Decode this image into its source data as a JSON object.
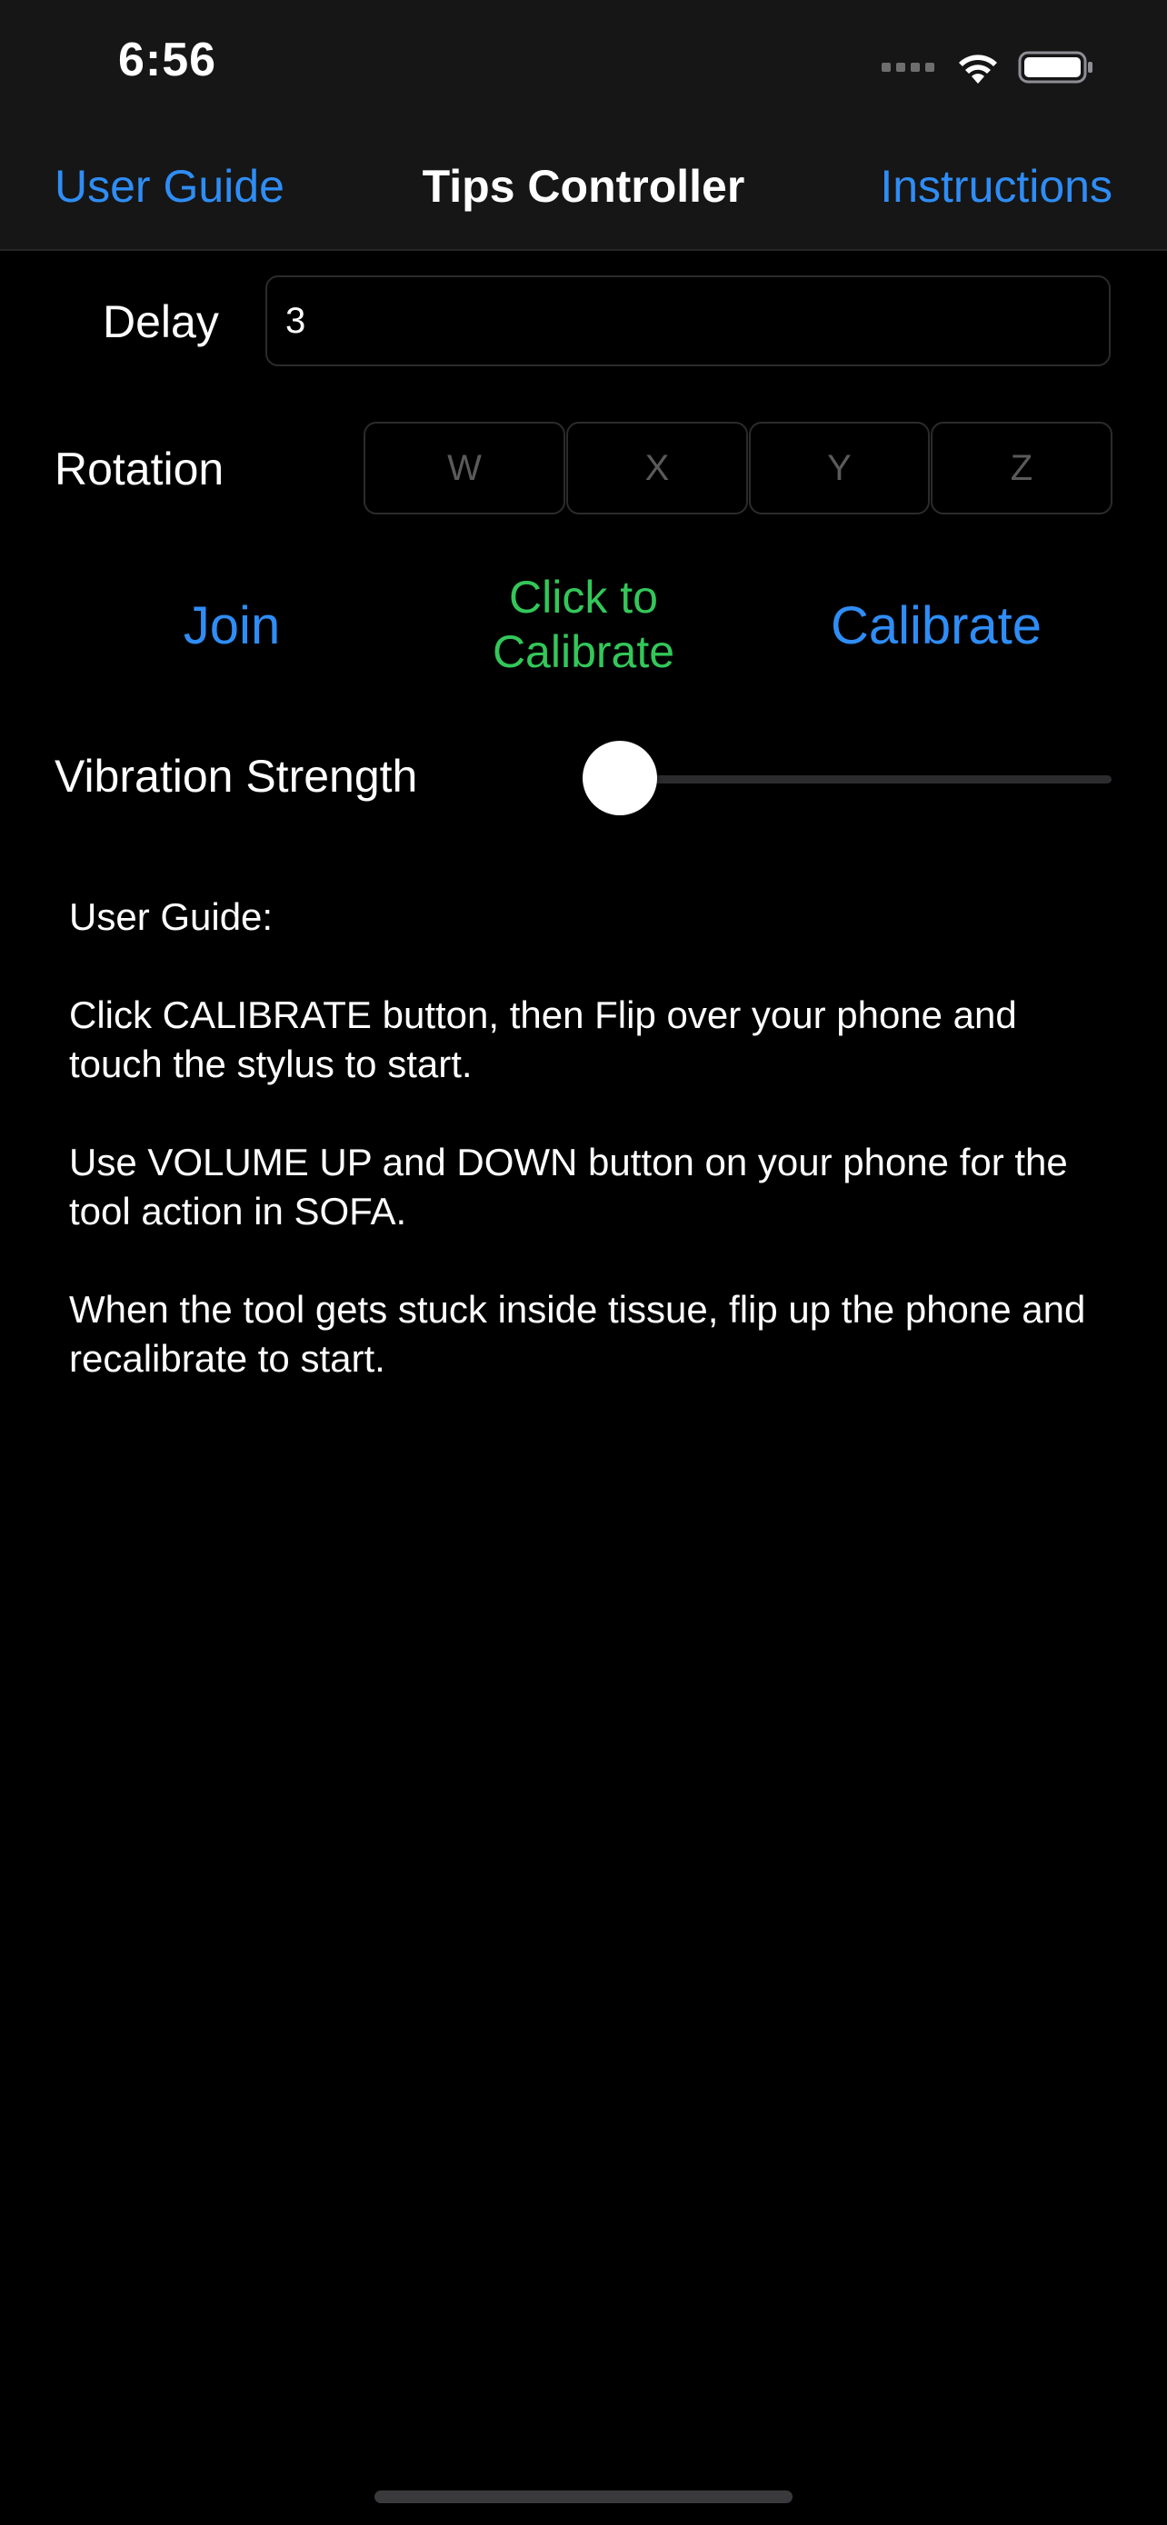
{
  "status_bar": {
    "time": "6:56",
    "icons": [
      "cellular-signal-icon",
      "wifi-icon",
      "battery-icon"
    ]
  },
  "nav": {
    "left_label": "User Guide",
    "title": "Tips Controller",
    "right_label": "Instructions"
  },
  "delay": {
    "label": "Delay",
    "value": "3"
  },
  "rotation": {
    "label": "Rotation",
    "fields": [
      {
        "placeholder": "W",
        "value": ""
      },
      {
        "placeholder": "X",
        "value": ""
      },
      {
        "placeholder": "Y",
        "value": ""
      },
      {
        "placeholder": "Z",
        "value": ""
      }
    ]
  },
  "actions": {
    "join_label": "Join",
    "status_text": "Click to Calibrate",
    "calibrate_label": "Calibrate"
  },
  "vibration": {
    "label": "Vibration Strength",
    "value": 0
  },
  "guide": {
    "heading": "User Guide:",
    "paragraphs": [
      "Click CALIBRATE button, then Flip over your phone and touch the stylus to start.",
      "Use VOLUME UP and DOWN button on your phone for the tool action in SOFA.",
      "When the tool gets stuck inside tissue, flip up the phone and recalibrate to start."
    ]
  },
  "colors": {
    "accent": "#2f8df5",
    "status_green": "#33c759",
    "background": "#000000",
    "nav_background": "#161616"
  }
}
